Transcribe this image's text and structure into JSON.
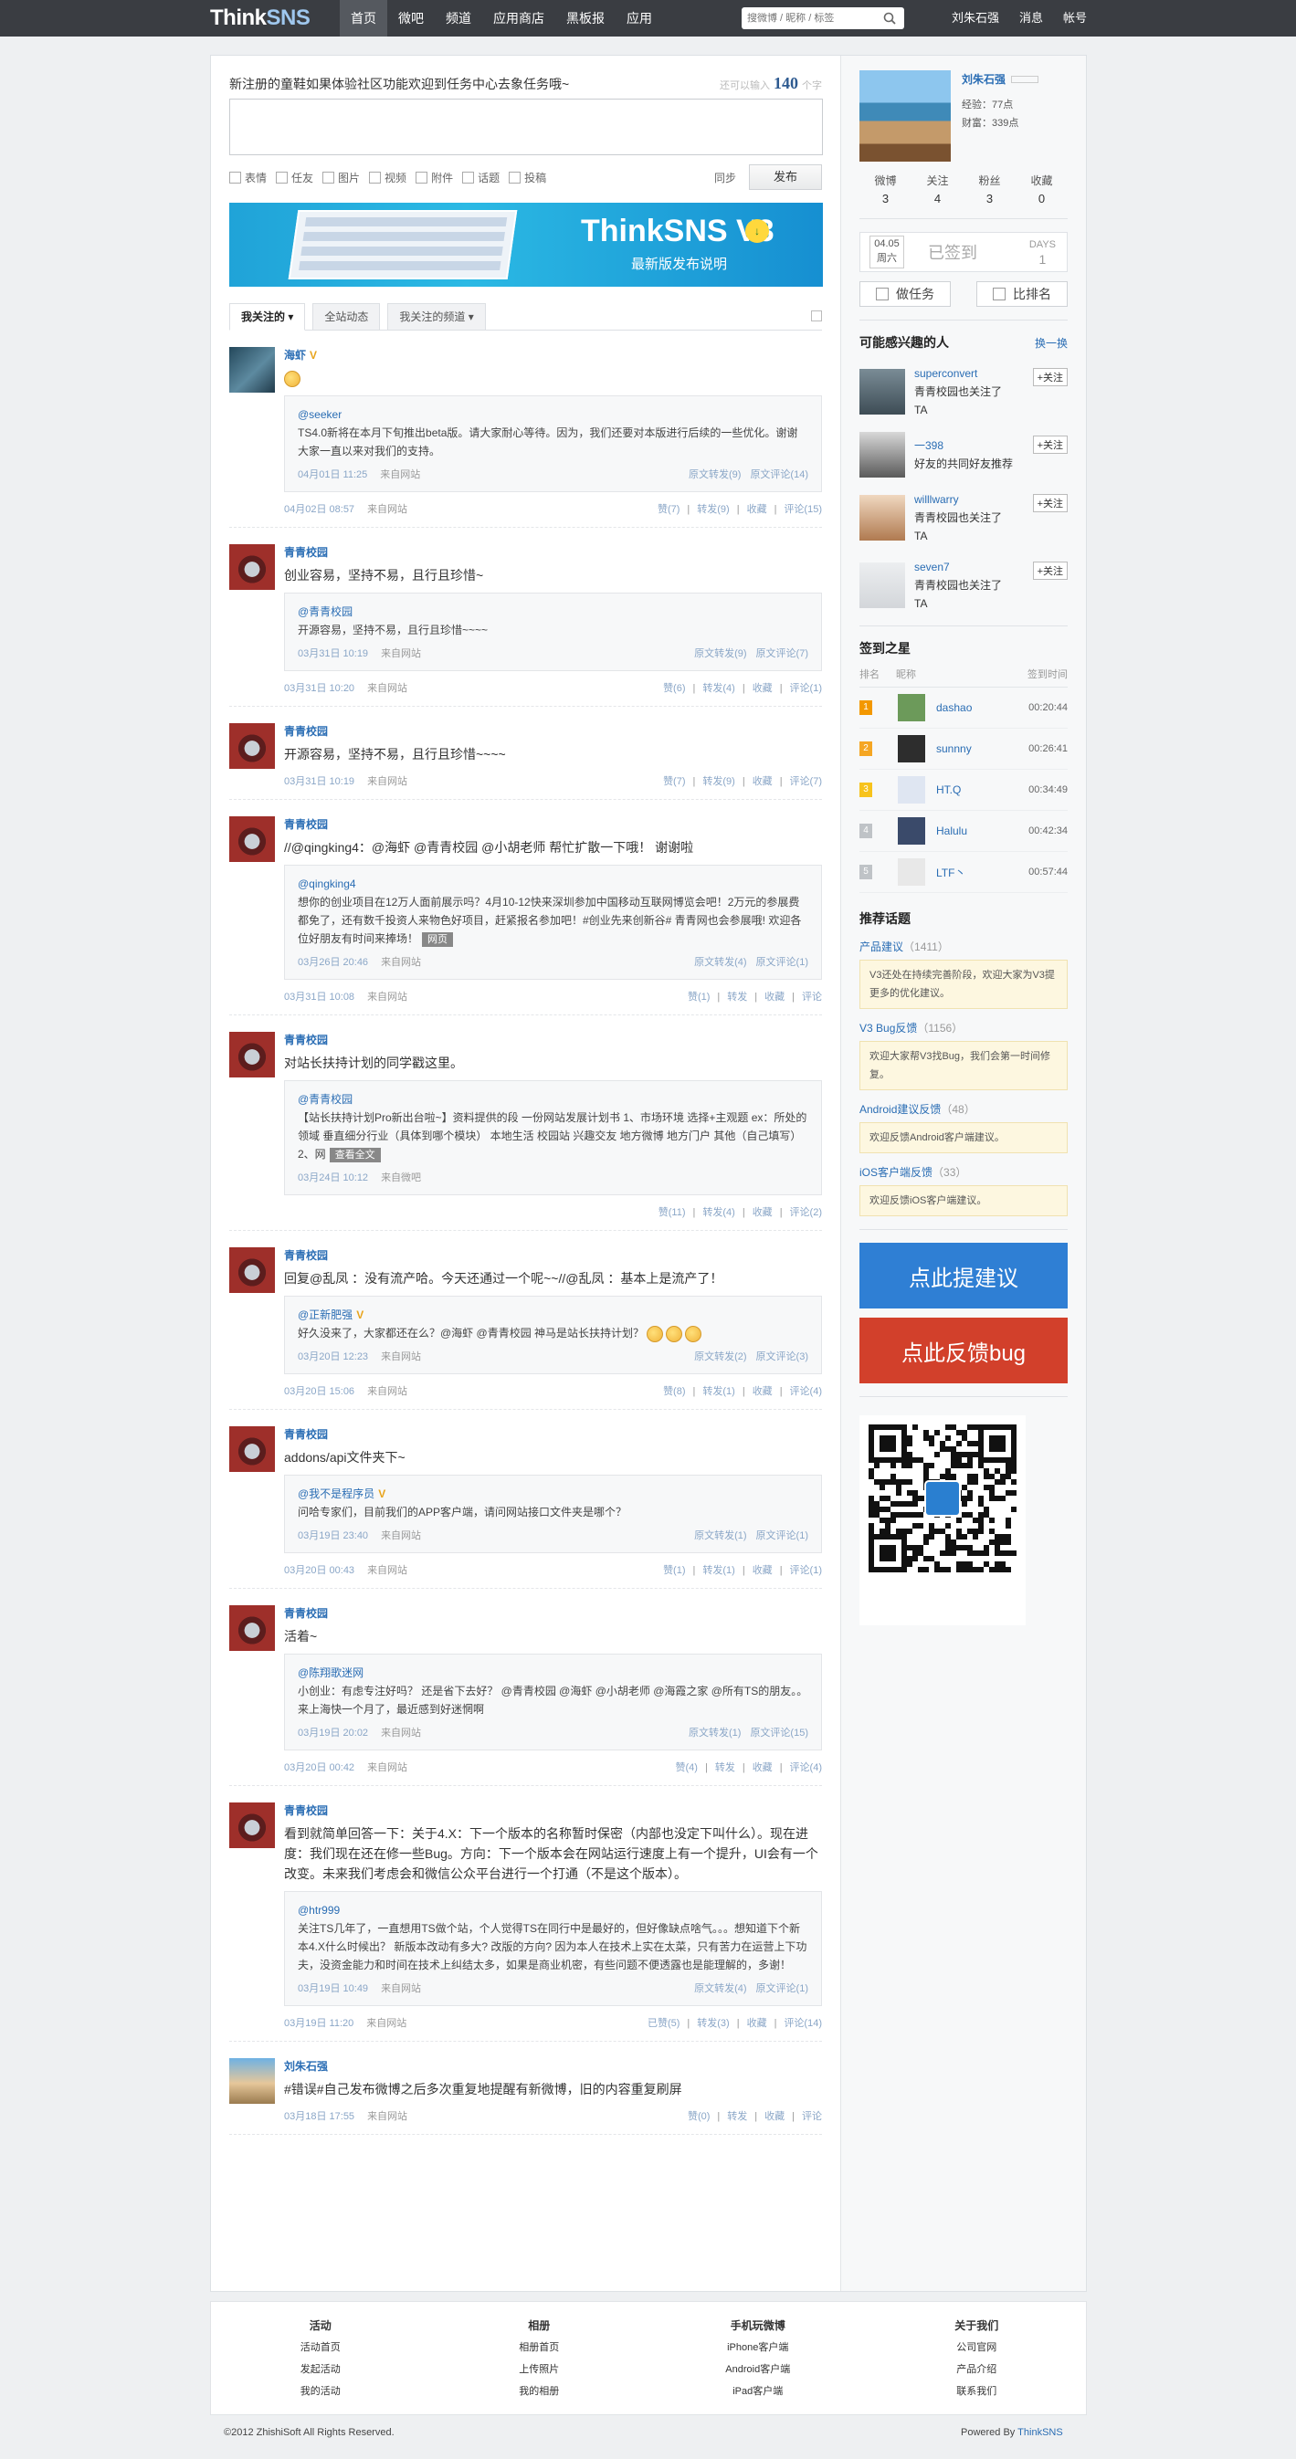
{
  "logo": "ThinkSNS",
  "nav": [
    "首页",
    "微吧",
    "频道",
    "应用商店",
    "黑板报",
    "应用"
  ],
  "search": {
    "placeholder": "搜微博 / 昵称 / 标签"
  },
  "user_links": [
    "刘朱石强",
    "消息",
    "帐号"
  ],
  "compose": {
    "prompt": "新注册的童鞋如果体验社区功能欢迎到任务中心去象任务哦~",
    "counter_prefix": "还可以输入",
    "counter_value": "140",
    "counter_suffix": "个字",
    "tools": [
      "表情",
      "任友",
      "图片",
      "视频",
      "附件",
      "话题",
      "投稿"
    ],
    "sync_label": "同步",
    "publish_label": "发布"
  },
  "banner": {
    "title": "ThinkSNS V3",
    "subtitle": "最新版发布说明"
  },
  "tabs": [
    "我关注的",
    "全站动态",
    "我关注的频道"
  ],
  "feed": [
    {
      "author": "海虾",
      "verified": "V",
      "content": "",
      "has_emoji": true,
      "repost": {
        "author": "@seeker",
        "text": "TS4.0新将在本月下旬推出beta版。请大家耐心等待。因为，我们还要对本版进行后续的一些优化。谢谢大家一直以来对我们的支持。",
        "time": "04月01日 11:25",
        "from": "来自网站",
        "stats": [
          "原文转发(9)",
          "原文评论(14)"
        ]
      },
      "time": "04月02日 08:57",
      "from": "来自网站",
      "actions": [
        "赞(7)",
        "转发(9)",
        "收藏",
        "评论(15)"
      ]
    },
    {
      "author": "青青校园",
      "verified": "",
      "content": "创业容易，坚持不易，且行且珍惜~",
      "repost": {
        "author": "@青青校园",
        "text": "开源容易，坚持不易，且行且珍惜~~~~",
        "time": "03月31日 10:19",
        "from": "来自网站",
        "stats": [
          "原文转发(9)",
          "原文评论(7)"
        ]
      },
      "time": "03月31日 10:20",
      "from": "来自网站",
      "actions": [
        "赞(6)",
        "转发(4)",
        "收藏",
        "评论(1)"
      ]
    },
    {
      "author": "青青校园",
      "verified": "",
      "content": "开源容易，坚持不易，且行且珍惜~~~~",
      "repost": null,
      "time": "03月31日 10:19",
      "from": "来自网站",
      "actions": [
        "赞(7)",
        "转发(9)",
        "收藏",
        "评论(7)"
      ]
    },
    {
      "author": "青青校园",
      "verified": "",
      "content": "//@qingking4：@海虾 @青青校园 @小胡老师 帮忙扩散一下哦！ 谢谢啦",
      "repost": {
        "author": "@qingking4",
        "text": "想你的创业项目在12万人面前展示吗？4月10-12快来深圳参加中国移动互联网博览会吧！2万元的参展费都免了，还有数千投资人来物色好项目，赶紧报名参加吧！#创业先来创新谷# 青青网也会参展哦! 欢迎各位好朋友有时间来捧场！",
        "tag": "网页",
        "time": "03月26日 20:46",
        "from": "来自网站",
        "stats": [
          "原文转发(4)",
          "原文评论(1)"
        ]
      },
      "time": "03月31日 10:08",
      "from": "来自网站",
      "actions": [
        "赞(1)",
        "转发",
        "收藏",
        "评论"
      ]
    },
    {
      "author": "青青校园",
      "verified": "",
      "content": "对站长扶持计划的同学戳这里。",
      "repost": {
        "author": "@青青校园",
        "text": "【站长扶持计划Pro新出台啦~】资料提供的段 一份网站发展计划书 1、市场环境 选择+主观题 ex：所处的领域 垂直细分行业（具体到哪个模块） 本地生活 校园站 兴趣交友 地方微博 地方门户 其他（自己填写） 2、网",
        "tag": "查看全文",
        "time": "03月24日 10:12",
        "from": "来自微吧",
        "stats": []
      },
      "time": "",
      "from": "",
      "actions": [
        "赞(11)",
        "转发(4)",
        "收藏",
        "评论(2)"
      ]
    },
    {
      "author": "青青校园",
      "verified": "",
      "content": "回复@乱凤 ：没有流产哈。今天还通过一个呢~~//@乱凤 ：基本上是流产了！",
      "repost": {
        "author": "@正新肥强",
        "verified": "V",
        "text": "好久没来了，大家都还在么？@海虾 @青青校园 神马是站长扶持计划？",
        "time": "03月20日 12:23",
        "from": "来自网站",
        "stats": [
          "原文转发(2)",
          "原文评论(3)"
        ],
        "emojis": 3
      },
      "time": "03月20日 15:06",
      "from": "来自网站",
      "actions": [
        "赞(8)",
        "转发(1)",
        "收藏",
        "评论(4)"
      ]
    },
    {
      "author": "青青校园",
      "verified": "",
      "content": "addons/api文件夹下~",
      "repost": {
        "author": "@我不是程序员",
        "verified": "V",
        "text": "问哈专家们，目前我们的APP客户端，请问网站接口文件夹是哪个？",
        "time": "03月19日 23:40",
        "from": "来自网站",
        "stats": [
          "原文转发(1)",
          "原文评论(1)"
        ]
      },
      "time": "03月20日 00:43",
      "from": "来自网站",
      "actions": [
        "赞(1)",
        "转发(1)",
        "收藏",
        "评论(1)"
      ]
    },
    {
      "author": "青青校园",
      "verified": "",
      "content": "活着~",
      "repost": {
        "author": "@陈翔歌迷网",
        "text": "小创业：有虑专注好吗？ 还是省下去好？ @青青校园 @海虾 @小胡老师 @海霞之家 @所有TS的朋友。。来上海快一个月了，最近感到好迷惘啊",
        "time": "03月19日 20:02",
        "from": "来自网站",
        "stats": [
          "原文转发(1)",
          "原文评论(15)"
        ]
      },
      "time": "03月20日 00:42",
      "from": "来自网站",
      "actions": [
        "赞(4)",
        "转发",
        "收藏",
        "评论(4)"
      ]
    },
    {
      "author": "青青校园",
      "verified": "",
      "content": "看到就简单回答一下：关于4.X：下一个版本的名称暂时保密（内部也没定下叫什么）。现在进度：我们现在还在修一些Bug。方向：下一个版本会在网站运行速度上有一个提升，UI会有一个改变。未来我们考虑会和微信公众平台进行一个打通（不是这个版本）。",
      "repost": {
        "author": "@htr999",
        "text": "关注TS几年了，一直想用TS做个站，个人觉得TS在同行中是最好的，但好像缺点啥气。。。想知道下个新本4.X什么时候出？ 新版本改动有多大? 改版的方向? 因为本人在技术上实在太菜，只有苦力在运营上下功夫，没资金能力和时间在技术上纠结太多，如果是商业机密，有些问题不便透露也是能理解的，多谢！",
        "time": "03月19日 10:49",
        "from": "来自网站",
        "stats": [
          "原文转发(4)",
          "原文评论(1)"
        ]
      },
      "time": "03月19日 11:20",
      "from": "来自网站",
      "actions": [
        "已赞(5)",
        "转发(3)",
        "收藏",
        "评论(14)"
      ]
    },
    {
      "author": "刘朱石强",
      "verified": "",
      "content": "#错误#自己发布微博之后多次重复地提醒有新微博，旧的内容重复刷屏",
      "repost": null,
      "time": "03月18日 17:55",
      "from": "来自网站",
      "actions": [
        "赞(0)",
        "转发",
        "收藏",
        "评论"
      ]
    }
  ],
  "profile": {
    "name": "刘朱石强",
    "exp": "经验：77点",
    "wealth": "财富：339点",
    "stats": [
      {
        "label": "微博",
        "value": "3"
      },
      {
        "label": "关注",
        "value": "4"
      },
      {
        "label": "粉丝",
        "value": "3"
      },
      {
        "label": "收藏",
        "value": "0"
      }
    ]
  },
  "checkin": {
    "date": "04.05",
    "weekday": "周六",
    "status": "已签到",
    "days_label": "DAYS",
    "days": "1"
  },
  "side_buttons": [
    "做任务",
    "比排名"
  ],
  "interests": {
    "title": "可能感兴趣的人",
    "refresh": "换一换",
    "people": [
      {
        "name": "superconvert",
        "reason": "青青校园也关注了TA",
        "follow": "+关注"
      },
      {
        "name": "一398",
        "reason": "好友的共同好友推荐",
        "follow": "+关注"
      },
      {
        "name": "willlwarry",
        "reason": "青青校园也关注了TA",
        "follow": "+关注"
      },
      {
        "name": "seven7",
        "reason": "青青校园也关注了TA",
        "follow": "+关注"
      }
    ]
  },
  "ranking": {
    "title": "签到之星",
    "headers": [
      "排名",
      "昵称",
      "签到时间"
    ],
    "rows": [
      {
        "rank": "1",
        "name": "dashao",
        "time": "00:20:44"
      },
      {
        "rank": "2",
        "name": "sunnny",
        "time": "00:26:41"
      },
      {
        "rank": "3",
        "name": "HT.Q",
        "time": "00:34:49"
      },
      {
        "rank": "4",
        "name": "Halulu",
        "time": "00:42:34"
      },
      {
        "rank": "5",
        "name": "LTF丶",
        "time": "00:57:44"
      }
    ]
  },
  "topics": {
    "title": "推荐话题",
    "items": [
      {
        "name": "产品建议",
        "count": "（1411）",
        "desc": "V3还处在持续完善阶段，欢迎大家为V3提更多的优化建议。"
      },
      {
        "name": "V3 Bug反馈",
        "count": "（1156）",
        "desc": "欢迎大家帮V3找Bug，我们会第一时间修复。"
      },
      {
        "name": "Android建议反馈",
        "count": "（48）",
        "desc": "欢迎反馈Android客户端建议。"
      },
      {
        "name": "iOS客户端反馈",
        "count": "（33）",
        "desc": "欢迎反馈iOS客户端建议。"
      }
    ]
  },
  "cta": {
    "suggest": "点此提建议",
    "bug": "点此反馈bug"
  },
  "colors": {
    "suggest": "#2f7fd4",
    "bug": "#d2402b",
    "nav": "#3a3d42",
    "link": "#2a6db4"
  },
  "footer": {
    "cols": [
      {
        "title": "活动",
        "links": [
          "活动首页",
          "发起活动",
          "我的活动"
        ]
      },
      {
        "title": "相册",
        "links": [
          "相册首页",
          "上传照片",
          "我的相册"
        ]
      },
      {
        "title": "手机玩微博",
        "links": [
          "iPhone客户端",
          "Android客户端",
          "iPad客户端"
        ]
      },
      {
        "title": "关于我们",
        "links": [
          "公司官网",
          "产品介绍",
          "联系我们"
        ]
      }
    ],
    "copyright": "©2012 ZhishiSoft All Rights Reserved.",
    "powered_prefix": "Powered By",
    "powered_brand": "ThinkSNS"
  }
}
